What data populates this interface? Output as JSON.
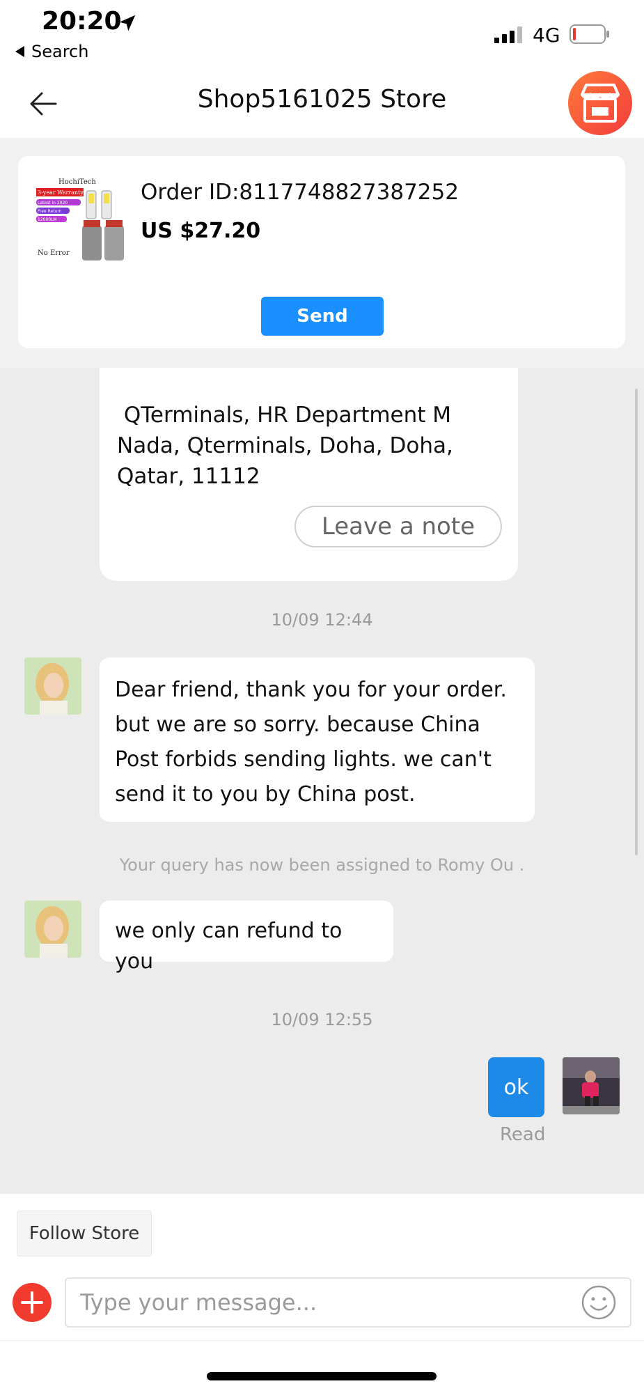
{
  "status_bar": {
    "time": "20:20",
    "back_label": "Search",
    "network": "4G"
  },
  "header": {
    "title": "Shop5161025 Store"
  },
  "order_card": {
    "order_id": "Order ID:8117748827387252",
    "price": "US $27.20",
    "send_label": "Send",
    "thumbnail_text": {
      "brand": "HochiTech",
      "warranty": "3-year Warranty",
      "line1": "Latest in 2020",
      "line2": "Free Return",
      "line3": "12000LM",
      "footer": "No Error"
    }
  },
  "chat": {
    "address_lines": [
      " QTerminals, HR Department M",
      "Nada, Qterminals, Doha, Doha,",
      "Qatar, 11112"
    ],
    "leave_note_label": "Leave a note",
    "timestamp_1": "10/09 12:44",
    "message_1": "Dear friend, thank you for your order. but we are so sorry. because China Post forbids sending lights. we can't send it to you by China post.",
    "system_note": "Your query has now been assigned to Romy Ou .",
    "message_2": "we only can refund to you",
    "timestamp_2": "10/09 12:55",
    "message_3": "ok",
    "read_label": "Read"
  },
  "footer": {
    "follow_label": "Follow Store",
    "input_placeholder": "Type your message..."
  },
  "colors": {
    "accent_blue": "#1a8fff",
    "bubble_blue": "#1e8ae8",
    "plus_red": "#f23b2f",
    "chat_bg": "#ececec"
  },
  "icons": [
    "location-arrow-icon",
    "signal-icon",
    "battery-icon",
    "back-arrow-icon",
    "store-icon",
    "plus-icon",
    "emoji-icon"
  ]
}
